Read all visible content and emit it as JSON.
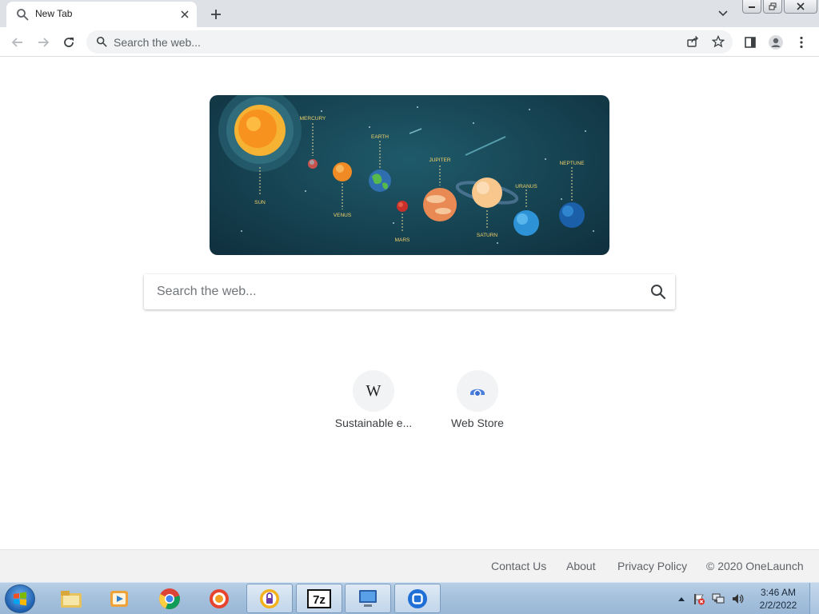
{
  "browser": {
    "tab": {
      "title": "New Tab"
    },
    "omnibox": {
      "placeholder": "Search the web..."
    }
  },
  "hero": {
    "labels": {
      "sun": "SUN",
      "mercury": "MERCURY",
      "venus": "VENUS",
      "earth": "EARTH",
      "mars": "MARS",
      "jupiter": "JUPITER",
      "saturn": "SATURN",
      "uranus": "URANUS",
      "neptune": "NEPTUNE"
    }
  },
  "search": {
    "placeholder": "Search the web..."
  },
  "shortcuts": [
    {
      "label": "Sustainable e...",
      "icon": "wikipedia-icon"
    },
    {
      "label": "Web Store",
      "icon": "chrome-web-store-icon"
    }
  ],
  "footer": {
    "contact": "Contact Us",
    "about": "About",
    "privacy": "Privacy Policy",
    "copyright": "© 2020 OneLaunch"
  },
  "taskbar": {
    "apps": [
      "file-explorer-icon",
      "media-player-icon",
      "chrome-icon",
      "app-icon",
      "vpn-icon",
      "7zip-icon",
      "computer-icon",
      "onelaunch-icon"
    ],
    "time": "3:46 AM",
    "date": "2/2/2022"
  }
}
